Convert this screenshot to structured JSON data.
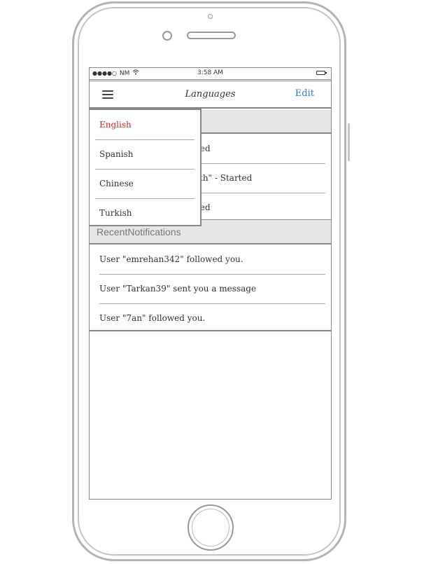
{
  "status_bar": {
    "signal": "●●●●○",
    "carrier": "NM",
    "wifi_icon": "wifi-icon",
    "time": "3:58 AM",
    "battery_icon": "battery-icon"
  },
  "nav": {
    "title": "Languages",
    "edit_label": "Edit",
    "menu_icon": "hamburger-menu-icon"
  },
  "activity_section": {
    "items": [
      {
        "text": "eted"
      },
      {
        "text": "alth\" - Started"
      },
      {
        "text": "eted"
      }
    ]
  },
  "notifications_section": {
    "header": "RecentNotifications",
    "items": [
      {
        "text": "User \"emrehan342\" followed you."
      },
      {
        "text": "User \"Tarkan39\" sent you a message"
      },
      {
        "text": "User \"7an\" followed you."
      }
    ]
  },
  "language_dropdown": {
    "selected": "English",
    "selected_color": "#d9281f",
    "options": [
      {
        "label": "English"
      },
      {
        "label": "Spanish"
      },
      {
        "label": "Chinese"
      },
      {
        "label": "Turkish"
      }
    ]
  },
  "colors": {
    "accent": "#2a7bd6",
    "section_bg": "#e6e6e6"
  }
}
